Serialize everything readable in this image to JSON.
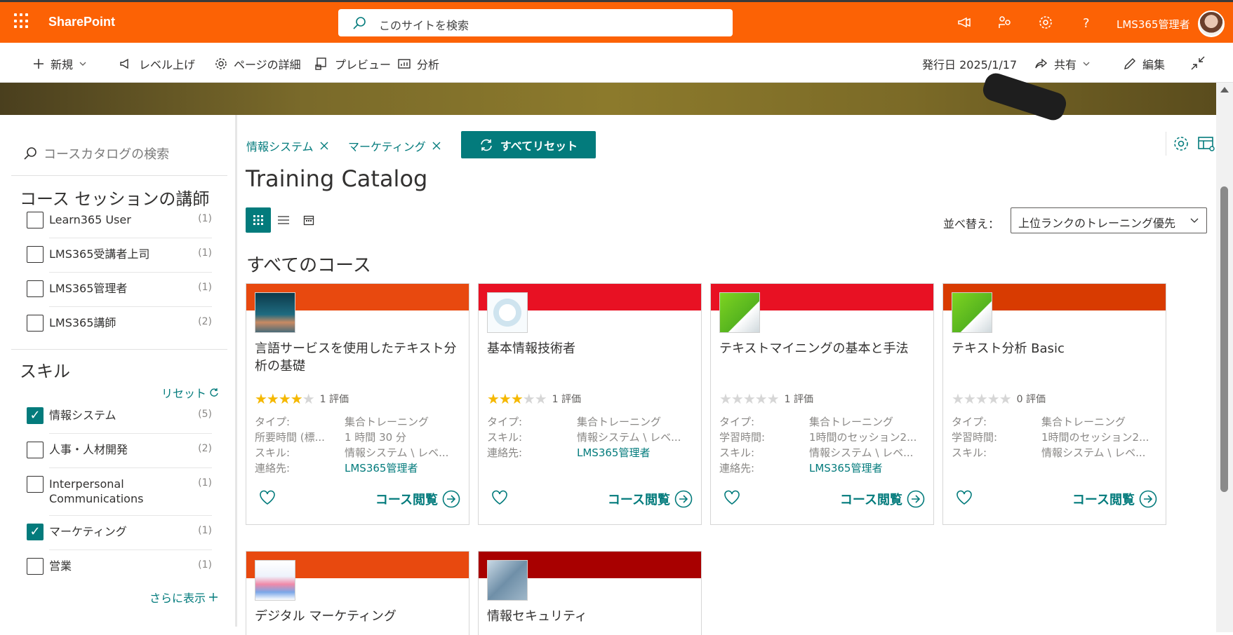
{
  "topbar": {
    "app": "SharePoint",
    "search_placeholder": "このサイトを検索",
    "user": "LMS365管理者"
  },
  "cmdbar": {
    "new": "新規",
    "level_up": "レベル上げ",
    "page_details": "ページの詳細",
    "preview": "プレビュー",
    "analytics": "分析",
    "published": "発行日 2025/1/17",
    "share": "共有",
    "edit": "編集"
  },
  "sidebar": {
    "search_placeholder": "コースカタログの検索",
    "instructors_heading": "コース セッションの講師",
    "instructors": [
      {
        "label": "Learn365 User",
        "count": "(1)"
      },
      {
        "label": "LMS365受講者上司",
        "count": "(1)"
      },
      {
        "label": "LMS365管理者",
        "count": "(1)"
      },
      {
        "label": "LMS365講師",
        "count": "(2)"
      }
    ],
    "skills_heading": "スキル",
    "reset": "リセット",
    "skills": [
      {
        "label": "情報システム",
        "count": "(5)",
        "checked": true
      },
      {
        "label": "人事・人材開発",
        "count": "(2)",
        "checked": false
      },
      {
        "label": "Interpersonal Communications",
        "count": "(1)",
        "checked": false
      },
      {
        "label": "マーケティング",
        "count": "(1)",
        "checked": true
      },
      {
        "label": "営業",
        "count": "(1)",
        "checked": false
      }
    ],
    "show_more": "さらに表示"
  },
  "main": {
    "chips": [
      "情報システム",
      "マーケティング"
    ],
    "reset_all": "すべてリセット",
    "title": "Training Catalog",
    "sort_label": "並べ替え：",
    "sort_value": "上位ランクのトレーニング優先",
    "section": "すべてのコース",
    "view_course": "コース閲覧",
    "cards": [
      {
        "title": "言語サービスを使用したテキスト分析の基礎",
        "rating": 4,
        "reviews": "1 評価",
        "head_color": "#e8490f",
        "meta": [
          {
            "k": "タイプ:",
            "v": "集合トレーニング"
          },
          {
            "k": "所要時間 (標...",
            "v": "1 時間 30 分"
          },
          {
            "k": "スキル:",
            "v": "情報システム \\ レベ..."
          },
          {
            "k": "連絡先:",
            "v": "LMS365管理者",
            "link": true
          }
        ]
      },
      {
        "title": "基本情報技術者",
        "rating": 3,
        "reviews": "1 評価",
        "head_color": "#e81123",
        "meta": [
          {
            "k": "タイプ:",
            "v": "集合トレーニング"
          },
          {
            "k": "スキル:",
            "v": "情報システム \\ レベ..."
          },
          {
            "k": "連絡先:",
            "v": "LMS365管理者",
            "link": true
          }
        ]
      },
      {
        "title": "テキストマイニングの基本と手法",
        "rating": 0,
        "reviews": "1 評価",
        "head_color": "#e81123",
        "meta": [
          {
            "k": "タイプ:",
            "v": "集合トレーニング"
          },
          {
            "k": "学習時間:",
            "v": "1時間のセッション2..."
          },
          {
            "k": "スキル:",
            "v": "情報システム \\ レベ..."
          },
          {
            "k": "連絡先:",
            "v": "LMS365管理者",
            "link": true
          }
        ]
      },
      {
        "title": "テキスト分析 Basic",
        "rating": 0,
        "reviews": "0 評価",
        "head_color": "#d83b01",
        "meta": [
          {
            "k": "タイプ:",
            "v": "集合トレーニング"
          },
          {
            "k": "学習時間:",
            "v": "1時間のセッション2..."
          },
          {
            "k": "スキル:",
            "v": "情報システム \\ レベ..."
          }
        ]
      },
      {
        "title": "デジタル マーケティング",
        "head_color": "#e8490f"
      },
      {
        "title": "情報セキュリティ",
        "head_color": "#a80000"
      }
    ]
  },
  "colors": {
    "accent": "#037b7c",
    "suite_bar": "#fc6205",
    "star": "#f5b800"
  }
}
